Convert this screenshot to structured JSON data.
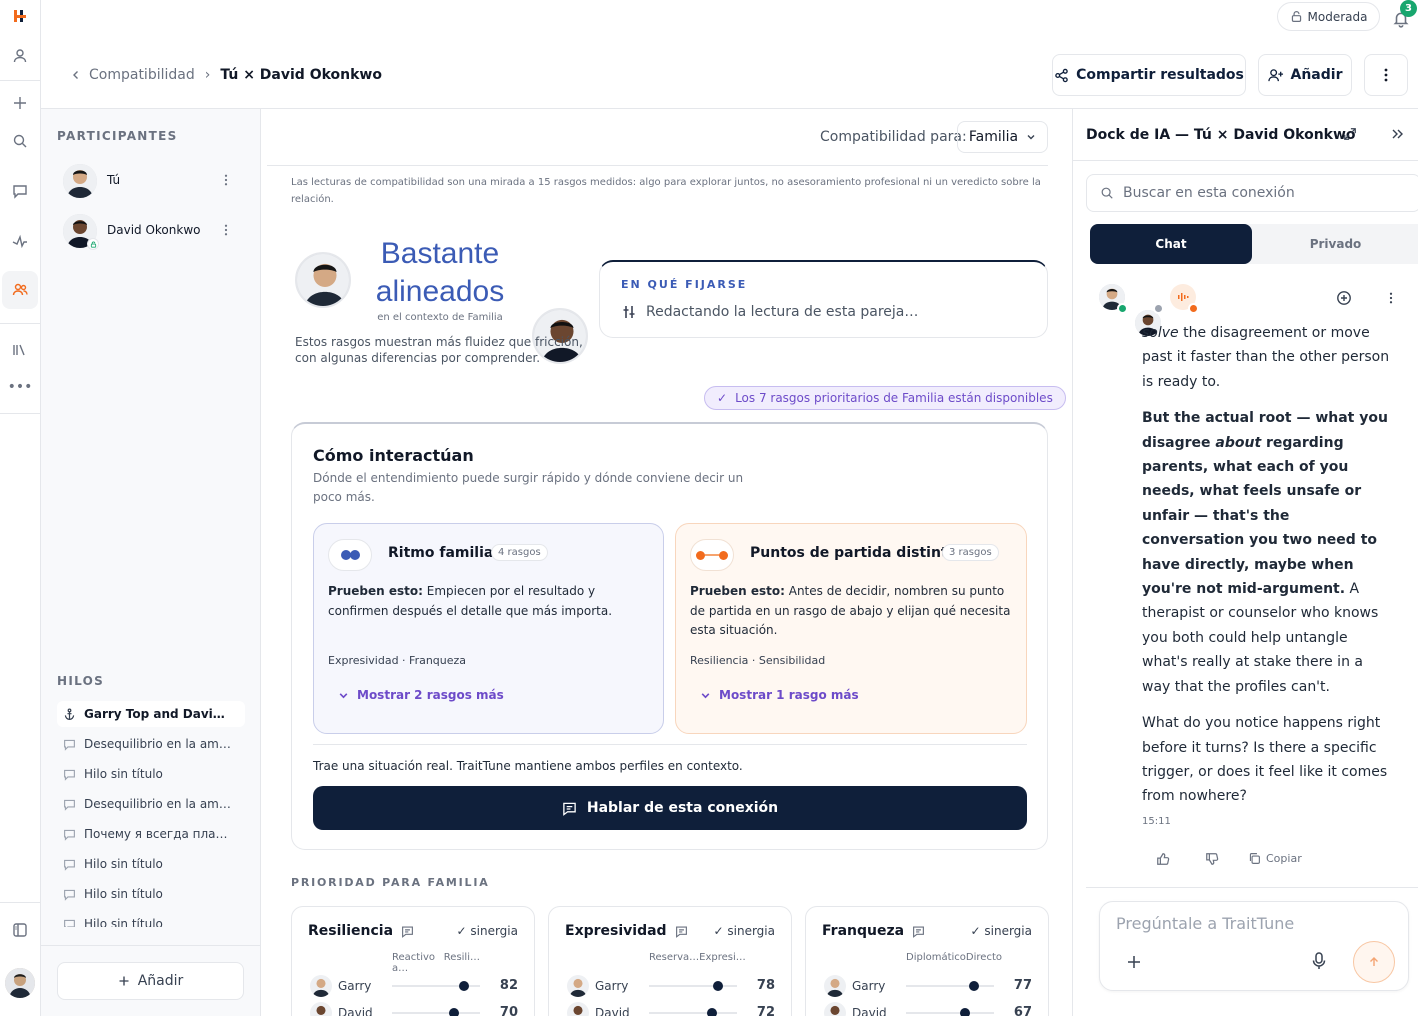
{
  "header": {
    "breadcrumb_parent": "Compatibilidad",
    "breadcrumb_sep": "›",
    "breadcrumb_current": "Tú × David Okonkwo",
    "mode_label": "Moderada",
    "notif_count": "3",
    "share_label": "Compartir resultados",
    "add_label": "Añadir"
  },
  "sidebar": {
    "participants_title": "PARTICIPANTES",
    "participants": [
      {
        "name": "Tú"
      },
      {
        "name": "David Okonkwo"
      }
    ],
    "threads_title": "HILOS",
    "threads": [
      {
        "label": "Garry Top and Davi…"
      },
      {
        "label": "Desequilibrio en la am…"
      },
      {
        "label": "Hilo sin título"
      },
      {
        "label": "Desequilibrio en la am…"
      },
      {
        "label": "Почему я всегда пла…"
      },
      {
        "label": "Hilo sin título"
      },
      {
        "label": "Hilo sin título"
      },
      {
        "label": "Hilo sin título"
      }
    ],
    "add_label": "Añadir"
  },
  "main": {
    "compat_for_label": "Compatibilidad para:",
    "compat_for_value": "Familia",
    "disclaimer": "Las lecturas de compatibilidad son una mirada a 15 rasgos medidos: algo para explorar juntos, no asesoramiento profesional ni un veredicto sobre la relación.",
    "verdict_line1": "Bastante",
    "verdict_line2": "alineados",
    "verdict_context": "en el contexto de Familia",
    "verdict_desc": "Estos rasgos muestran más fluidez que fricción, con algunas diferencias por comprender.",
    "watch_title": "EN QUÉ FIJARSE",
    "watch_status": "Redactando la lectura de esta pareja…",
    "priority_badge": "Los 7 rasgos prioritarios de Familia están disponibles",
    "interact_title": "Cómo interactúan",
    "interact_desc": "Dónde el entendimiento puede surgir rápido y dónde conviene decir un poco más.",
    "rhythm": {
      "title": "Ritmo familiar",
      "count": "4 rasgos",
      "try_label": "Prueben esto:",
      "try_text": "Empiecen por el resultado y confirmen después el detalle que más importa.",
      "traits": "Expresividad · Franqueza",
      "more": "Mostrar 2 rasgos más"
    },
    "starts": {
      "title": "Puntos de partida distintos",
      "count": "3 rasgos",
      "try_label": "Prueben esto:",
      "try_text": "Antes de decidir, nombren su punto de partida en un rasgo de abajo y elijan qué necesita esta situación.",
      "traits": "Resiliencia · Sensibilidad",
      "more": "Mostrar 1 rasgo más"
    },
    "real_situation": "Trae una situación real. TraitTune mantiene ambos perfiles en contexto.",
    "talk_button": "Hablar de esta conexión",
    "priority_title": "PRIORIDAD PARA FAMILIA",
    "trait_cards": [
      {
        "name": "Resiliencia",
        "tag": "✓ sinergia",
        "left": "Reactivo a…",
        "right": "Resili…",
        "p1": "Garry",
        "v1": "82",
        "p2": "David",
        "v2": "70",
        "pos1": 0.82,
        "pos2": 0.7
      },
      {
        "name": "Expresividad",
        "tag": "✓ sinergia",
        "left": "Reserva…",
        "right": "Expresi…",
        "p1": "Garry",
        "v1": "78",
        "p2": "David",
        "v2": "72",
        "pos1": 0.78,
        "pos2": 0.72
      },
      {
        "name": "Franqueza",
        "tag": "✓ sinergia",
        "left": "Diplomático",
        "right": "Directo",
        "p1": "Garry",
        "v1": "77",
        "p2": "David",
        "v2": "67",
        "pos1": 0.77,
        "pos2": 0.67
      }
    ]
  },
  "dock": {
    "title": "Dock de IA — Tú × David Okonkwo",
    "search_placeholder": "Buscar en esta conexión",
    "tab_chat": "Chat",
    "tab_private": "Privado",
    "msg_p1_em": "solve",
    "msg_p1_rest": " the disagreement or move past it faster than the other person is ready to.",
    "msg_p2_bold1": "But the actual root — what you disagree ",
    "msg_p2_em": "about",
    "msg_p2_bold2": " regarding parents, what each of you needs, what feels unsafe or unfair — that's the conversation you two need to have directly, maybe when you're not mid-argument.",
    "msg_p2_rest": " A therapist or counselor who knows you both could help untangle what's really at stake there in a way that the profiles can't.",
    "msg_p3": "What do you notice happens right before it turns? Is there a specific trigger, or does it feel like it comes from nowhere?",
    "timestamp": "15:11",
    "copy_label": "Copiar",
    "input_placeholder": "Pregúntale a TraitTune"
  },
  "colors": {
    "navy": "#0f1f3a",
    "accent_blue": "#3b5bb5",
    "accent_orange": "#f26b1d",
    "purple": "#6d4bc9"
  }
}
